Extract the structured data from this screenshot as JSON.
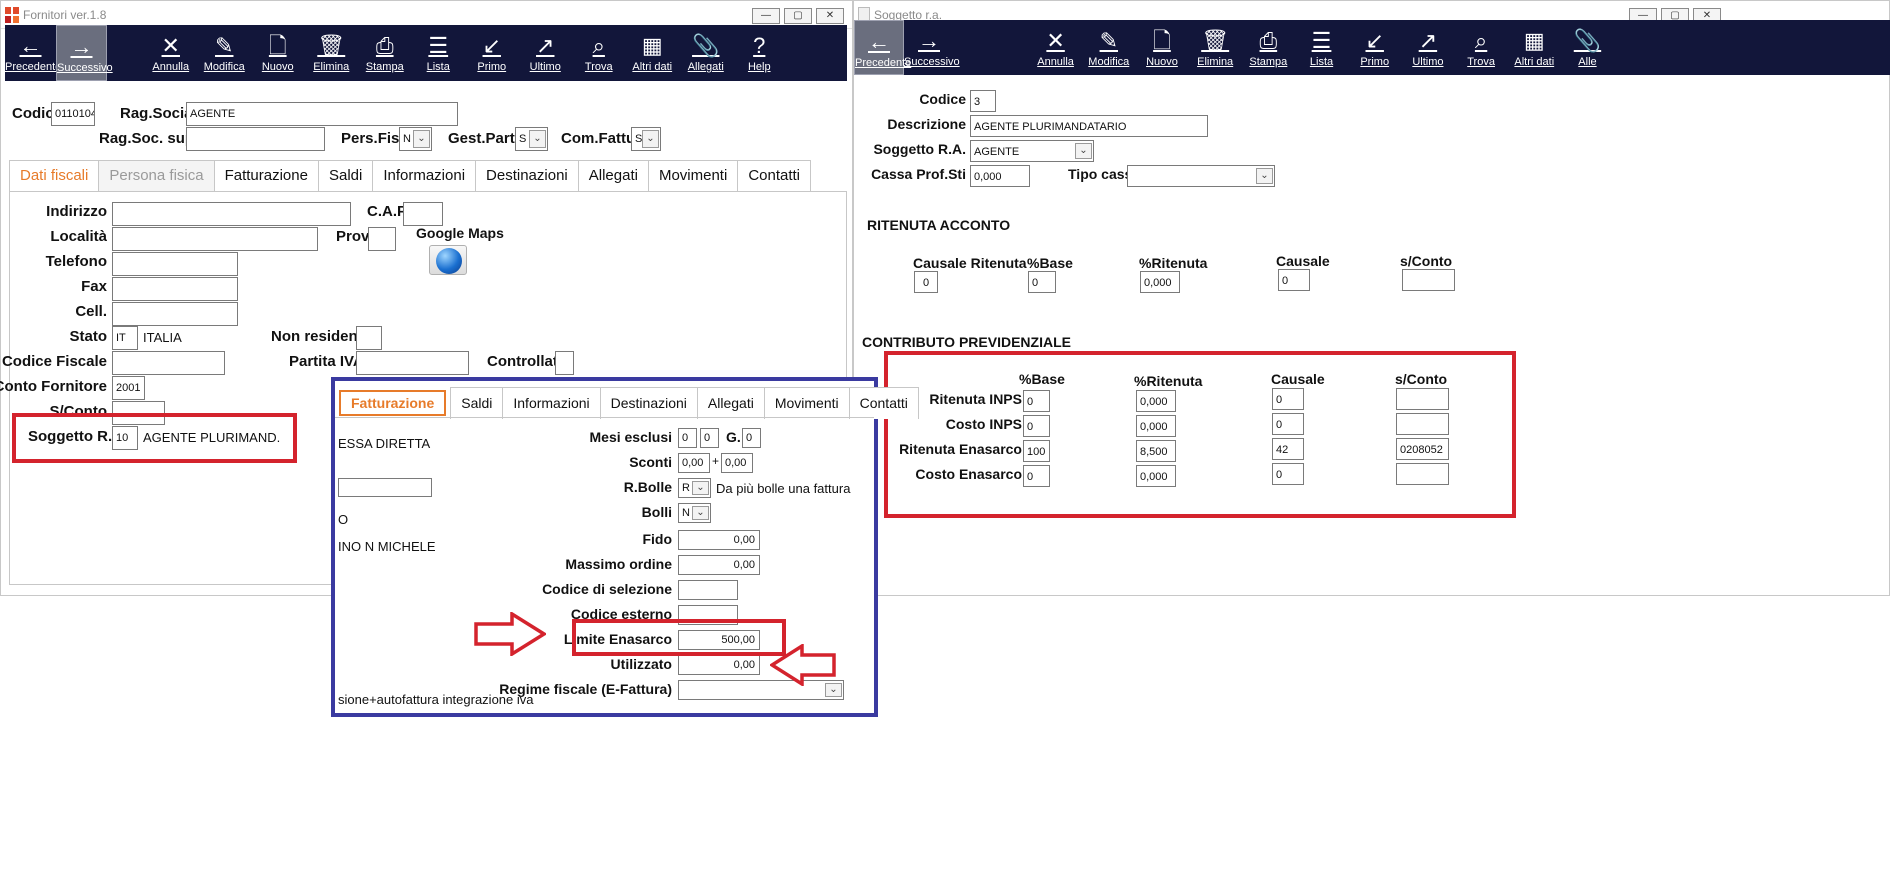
{
  "left_window": {
    "title": "Fornitori ver.1.8",
    "win_buttons": [
      "—",
      "▢",
      "✕"
    ],
    "toolbar": [
      {
        "label": "Precedente",
        "icon": "arrow-left-icon",
        "glyph": "←"
      },
      {
        "label": "Successivo",
        "icon": "arrow-right-icon",
        "glyph": "→"
      },
      {
        "label": "Annulla",
        "icon": "close-icon",
        "glyph": "✕"
      },
      {
        "label": "Modifica",
        "icon": "edit-icon",
        "glyph": "✎"
      },
      {
        "label": "Nuovo",
        "icon": "new-document-icon",
        "glyph": "🗋"
      },
      {
        "label": "Elimina",
        "icon": "trash-icon",
        "glyph": "🗑"
      },
      {
        "label": "Stampa",
        "icon": "printer-icon",
        "glyph": "⎙"
      },
      {
        "label": "Lista",
        "icon": "list-icon",
        "glyph": "☰"
      },
      {
        "label": "Primo",
        "icon": "arrow-first-icon",
        "glyph": "↙"
      },
      {
        "label": "Ultimo",
        "icon": "arrow-last-icon",
        "glyph": "↗"
      },
      {
        "label": "Trova",
        "icon": "search-icon",
        "glyph": "⌕"
      },
      {
        "label": "Altri dati",
        "icon": "grid-icon",
        "glyph": "▦"
      },
      {
        "label": "Allegati",
        "icon": "paperclip-icon",
        "glyph": "📎"
      },
      {
        "label": "Help",
        "icon": "help-icon",
        "glyph": "?"
      }
    ],
    "header": {
      "codice_label": "Codice",
      "codice": "0110104",
      "ragsoc_label": "Rag.Sociale",
      "ragsoc": "AGENTE",
      "ragsoc_suppl_label": "Rag.Soc. suppl.",
      "ragsoc_suppl": "",
      "pers_fisica_label": "Pers.Fisica",
      "pers_fisica": "N",
      "gest_partite_label": "Gest.Partite",
      "gest_partite": "S",
      "com_fatture_label": "Com.Fatture",
      "com_fatture": "S"
    },
    "tabs": [
      "Dati fiscali",
      "Persona fisica",
      "Fatturazione",
      "Saldi",
      "Informazioni",
      "Destinazioni",
      "Allegati",
      "Movimenti",
      "Contatti"
    ],
    "dati_fiscali": {
      "indirizzo_label": "Indirizzo",
      "cap_label": "C.A.P.",
      "localita_label": "Località",
      "prov_label": "Prov.",
      "google_maps_label": "Google Maps",
      "telefono_label": "Telefono",
      "fax_label": "Fax",
      "cell_label": "Cell.",
      "stato_label": "Stato",
      "stato_code": "IT",
      "stato_name": "ITALIA",
      "non_residente_label": "Non residente",
      "codice_fiscale_label": "Codice Fiscale",
      "partita_iva_label": "Partita IVA",
      "controllata_label": "Controllata",
      "conto_fornitore_label": "Conto Fornitore",
      "conto_fornitore": "2001",
      "sconto_label": "S/Conto",
      "soggetto_ra_label": "Soggetto R.A.",
      "soggetto_ra_code": "10",
      "soggetto_ra_name": "AGENTE PLURIMAND."
    }
  },
  "overlay": {
    "tabs": [
      "Fatturazione",
      "Saldi",
      "Informazioni",
      "Destinazioni",
      "Allegati",
      "Movimenti",
      "Contatti"
    ],
    "left_texts": [
      "ESSA DIRETTA",
      "O",
      "INO N MICHELE",
      "sione+autofattura integrazione iva"
    ],
    "mesi_esclusi_label": "Mesi esclusi",
    "mesi_a": "0",
    "mesi_b": "0",
    "g_label": "G.",
    "g": "0",
    "sconti_label": "Sconti",
    "sconto1": "0,00",
    "plus": "+",
    "sconto2": "0,00",
    "rbolle_label": "R.Bolle",
    "rbolle": "R",
    "rbolle_desc": "Da più bolle una fattura",
    "bolli_label": "Bolli",
    "bolli": "N",
    "fido_label": "Fido",
    "fido": "0,00",
    "massimo_ordine_label": "Massimo ordine",
    "massimo_ordine": "0,00",
    "codice_selezione_label": "Codice di selezione",
    "codice_esterno_label": "Codice esterno",
    "limite_enasarco_label": "Limite Enasarco",
    "limite_enasarco": "500,00",
    "utilizzato_label": "Utilizzato",
    "utilizzato": "0,00",
    "regime_fiscale_label": "Regime fiscale (E-Fattura)"
  },
  "right_window": {
    "title": "Soggetto r.a.",
    "win_buttons": [
      "—",
      "▢",
      "✕"
    ],
    "toolbar": [
      {
        "label": "Precedente",
        "icon": "arrow-left-icon",
        "glyph": "←"
      },
      {
        "label": "Successivo",
        "icon": "arrow-right-icon",
        "glyph": "→"
      },
      {
        "label": "Annulla",
        "icon": "close-icon",
        "glyph": "✕"
      },
      {
        "label": "Modifica",
        "icon": "edit-icon",
        "glyph": "✎"
      },
      {
        "label": "Nuovo",
        "icon": "new-document-icon",
        "glyph": "🗋"
      },
      {
        "label": "Elimina",
        "icon": "trash-icon",
        "glyph": "🗑"
      },
      {
        "label": "Stampa",
        "icon": "printer-icon",
        "glyph": "⎙"
      },
      {
        "label": "Lista",
        "icon": "list-icon",
        "glyph": "☰"
      },
      {
        "label": "Primo",
        "icon": "arrow-first-icon",
        "glyph": "↙"
      },
      {
        "label": "Ultimo",
        "icon": "arrow-last-icon",
        "glyph": "↗"
      },
      {
        "label": "Trova",
        "icon": "search-icon",
        "glyph": "⌕"
      },
      {
        "label": "Altri dati",
        "icon": "grid-icon",
        "glyph": "▦"
      },
      {
        "label": "Alle",
        "icon": "paperclip-icon",
        "glyph": "📎"
      }
    ],
    "codice_label": "Codice",
    "codice": "3",
    "descrizione_label": "Descrizione",
    "descrizione": "AGENTE PLURIMANDATARIO",
    "soggetto_ra_label": "Soggetto R.A.",
    "soggetto_ra": "AGENTE",
    "cassa_label": "Cassa Prof.Sti",
    "cassa": "0,000",
    "tipo_cassa_label": "Tipo cassa",
    "ritenuta_acconto_title": "RITENUTA ACCONTO",
    "ra_headers": [
      "Causale Ritenuta",
      "%Base",
      "%Ritenuta",
      "Causale",
      "s/Conto"
    ],
    "ra_values": [
      "0",
      "0",
      "0,000",
      "0",
      ""
    ],
    "contributo_title": "CONTRIBUTO PREVIDENZIALE",
    "cp_headers": [
      "%Base",
      "%Ritenuta",
      "Causale",
      "s/Conto"
    ],
    "cp_rows": [
      {
        "label": "Ritenuta INPS",
        "base": "0",
        "rit": "0,000",
        "causale": "0",
        "sconto": ""
      },
      {
        "label": "Costo INPS",
        "base": "0",
        "rit": "0,000",
        "causale": "0",
        "sconto": ""
      },
      {
        "label": "Ritenuta Enasarco",
        "base": "100",
        "rit": "8,500",
        "causale": "42",
        "sconto": "0208052"
      },
      {
        "label": "Costo Enasarco",
        "base": "0",
        "rit": "0,000",
        "causale": "0",
        "sconto": ""
      }
    ]
  }
}
